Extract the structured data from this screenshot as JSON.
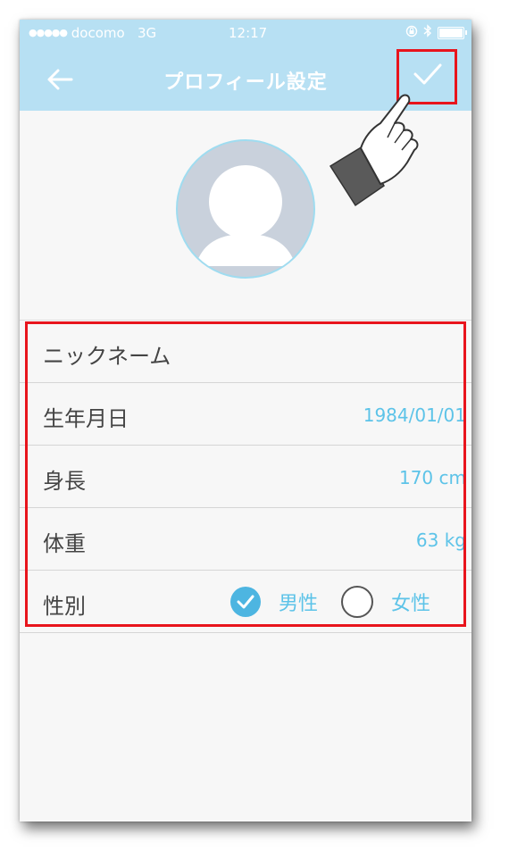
{
  "status_bar": {
    "signal": "●●●●●",
    "carrier": "docomo",
    "network": "3G",
    "time": "12:17",
    "icons": [
      "orientation-lock-icon",
      "bluetooth-icon",
      "battery-icon"
    ]
  },
  "nav": {
    "title": "プロフィール設定",
    "back_icon": "arrow-left-icon",
    "confirm_icon": "checkmark-icon"
  },
  "profile": {
    "avatar_icon": "user-avatar-icon"
  },
  "fields": [
    {
      "label": "ニックネーム",
      "value": ""
    },
    {
      "label": "生年月日",
      "value": "1984/01/01"
    },
    {
      "label": "身長",
      "value": "170 cm"
    },
    {
      "label": "体重",
      "value": "63 kg"
    }
  ],
  "gender": {
    "label": "性別",
    "options": [
      {
        "label": "男性",
        "selected": true
      },
      {
        "label": "女性",
        "selected": false
      }
    ]
  },
  "colors": {
    "header": "#b7e0f3",
    "accent": "#5cc3e8",
    "highlight_frame": "#e8141c",
    "background": "#f7f7f7"
  }
}
